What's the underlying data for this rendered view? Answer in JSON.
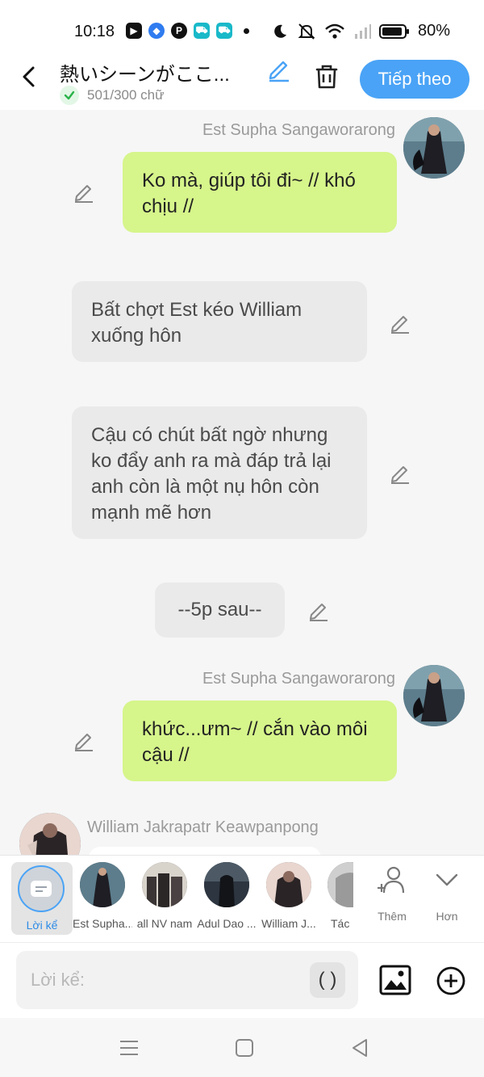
{
  "status_bar": {
    "time": "10:18",
    "battery": "80%",
    "app_icons": [
      "screen-recorder-icon",
      "browser-icon",
      "pinterest-icon",
      "shop-icon",
      "shop-icon"
    ]
  },
  "header": {
    "title": "熱いシーンがここ...",
    "word_count": "501/300 chữ",
    "next_label": "Tiếp theo"
  },
  "messages": [
    {
      "type": "character",
      "side": "right",
      "sender": "Est Supha Sangaworarong",
      "text": "Ko mà, giúp tôi đi~ // khó chịu //"
    },
    {
      "type": "narration",
      "text": "Bất chợt Est kéo William xuống hôn"
    },
    {
      "type": "narration",
      "text": "Cậu có chút bất ngờ nhưng ko đẩy anh ra mà đáp trả lại anh còn là một nụ hôn còn mạnh mẽ hơn"
    },
    {
      "type": "narration",
      "text": "--5p sau--"
    },
    {
      "type": "character",
      "side": "right",
      "sender": "Est Supha Sangaworarong",
      "text": "khức...ưm~ // cắn vào môi cậu //"
    },
    {
      "type": "character",
      "side": "left",
      "sender": "William Jakrapatr Keawpanpong",
      "text": ""
    }
  ],
  "tray": {
    "narrator_label": "Lời kể",
    "characters": [
      "Est Supha...",
      "all NV nam",
      "Adul Dao ...",
      "William J...",
      "Tác"
    ],
    "add_label": "Thêm",
    "more_label": "Hơn"
  },
  "input": {
    "placeholder": "Lời kể:",
    "paren_label": "( )"
  },
  "colors": {
    "accent": "#4aa3f6",
    "bubble_green": "#d6f58b",
    "bubble_grey": "#eaeaea"
  }
}
